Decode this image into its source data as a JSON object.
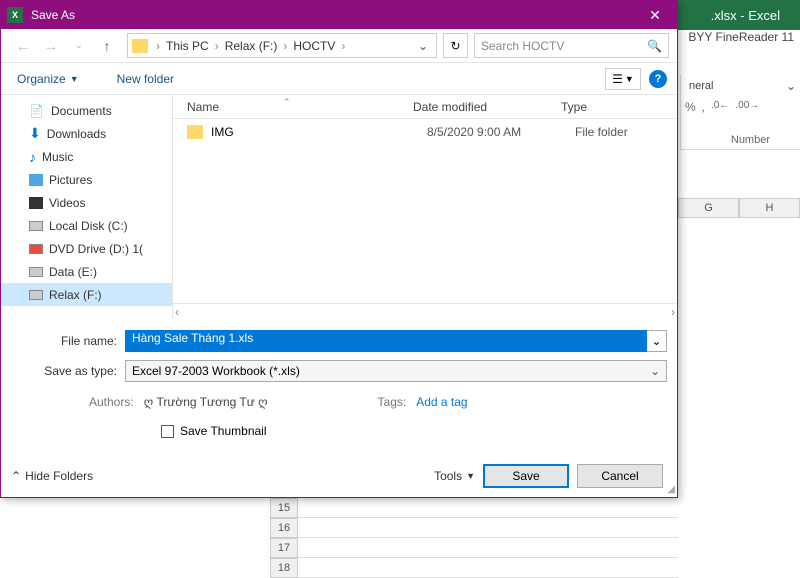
{
  "excel": {
    "title_suffix": ".xlsx - Excel",
    "app_hint": "BYY FineReader 11",
    "ribbon_group": "neral",
    "section_label": "Number",
    "cols": [
      "G",
      "H"
    ],
    "rows": [
      "15",
      "16",
      "17",
      "18"
    ]
  },
  "dialog": {
    "title": "Save As",
    "breadcrumb": [
      "This PC",
      "Relax (F:)",
      "HOCTV"
    ],
    "search_placeholder": "Search HOCTV",
    "organize": "Organize",
    "new_folder": "New folder",
    "tree": [
      {
        "label": "Documents",
        "icon": "doc"
      },
      {
        "label": "Downloads",
        "icon": "dl"
      },
      {
        "label": "Music",
        "icon": "music"
      },
      {
        "label": "Pictures",
        "icon": "pic"
      },
      {
        "label": "Videos",
        "icon": "vid"
      },
      {
        "label": "Local Disk (C:)",
        "icon": "disk"
      },
      {
        "label": "DVD Drive (D:) 1(",
        "icon": "dvd"
      },
      {
        "label": "Data (E:)",
        "icon": "disk"
      },
      {
        "label": "Relax (F:)",
        "icon": "disk",
        "selected": true
      }
    ],
    "columns": {
      "name": "Name",
      "date": "Date modified",
      "type": "Type"
    },
    "files": [
      {
        "name": "IMG",
        "date": "8/5/2020 9:00 AM",
        "type": "File folder"
      }
    ],
    "filename_label": "File name:",
    "filename": "Hàng Sale Tháng 1.xls",
    "savetype_label": "Save as type:",
    "savetype": "Excel 97-2003 Workbook (*.xls)",
    "authors_label": "Authors:",
    "authors": "ღ Trường Tương Tư ღ",
    "tags_label": "Tags:",
    "tags_hint": "Add a tag",
    "thumb": "Save Thumbnail",
    "hide_folders": "Hide Folders",
    "tools": "Tools",
    "save": "Save",
    "cancel": "Cancel"
  }
}
